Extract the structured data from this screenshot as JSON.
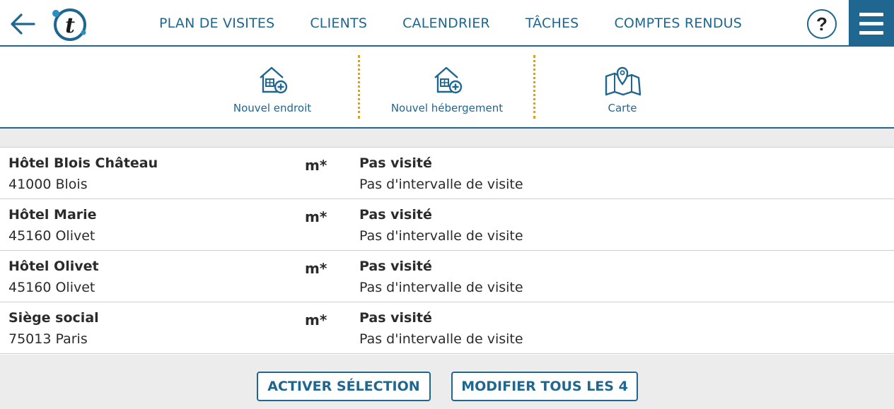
{
  "header": {
    "nav": [
      "PLAN DE VISITES",
      "CLIENTS",
      "CALENDRIER",
      "TÂCHES",
      "COMPTES RENDUS"
    ],
    "help_label": "?",
    "logo_letter": "t"
  },
  "toolbar": {
    "new_place": "Nouvel endroit",
    "new_lodging": "Nouvel hébergement",
    "map": "Carte"
  },
  "rows": [
    {
      "name": "Hôtel Blois Château",
      "city": "41000 Blois",
      "code": "m*",
      "status": "Pas visité",
      "interval": "Pas d'intervalle de visite"
    },
    {
      "name": "Hôtel Marie",
      "city": "45160 Olivet",
      "code": "m*",
      "status": "Pas visité",
      "interval": "Pas d'intervalle de visite"
    },
    {
      "name": "Hôtel Olivet",
      "city": "45160 Olivet",
      "code": "m*",
      "status": "Pas visité",
      "interval": "Pas d'intervalle de visite"
    },
    {
      "name": "Siège social",
      "city": "75013 Paris",
      "code": "m*",
      "status": "Pas visité",
      "interval": "Pas d'intervalle de visite"
    }
  ],
  "footer": {
    "activate": "ACTIVER SÉLECTION",
    "modify_all": "MODIFIER TOUS LES 4"
  },
  "colors": {
    "brand": "#1f6690",
    "separator": "#d8a21c",
    "band": "#ececec",
    "logo_accent": "#2a8fc1"
  },
  "icons": {
    "back": "arrow-left-icon",
    "help": "question-icon",
    "menu": "hamburger-menu-icon",
    "new_place": "house-plus-icon",
    "new_lodging": "house-plus-icon",
    "map": "map-pin-icon"
  }
}
